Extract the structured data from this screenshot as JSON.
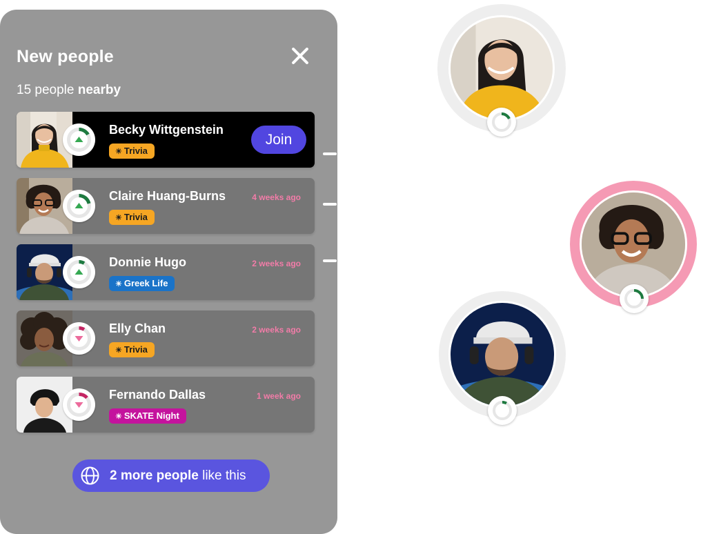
{
  "panel": {
    "title": "New people",
    "nearby_count": "15 people",
    "nearby_word": "nearby",
    "close_icon": "close-icon"
  },
  "people": [
    {
      "name": "Becky Wittgenstein",
      "tag": "Trivia",
      "tag_color": "#f6a623",
      "time": "",
      "action": "Join",
      "active": true,
      "status": "up",
      "status_color": "#35a852"
    },
    {
      "name": "Claire Huang-Burns",
      "tag": "Trivia",
      "tag_color": "#f6a623",
      "time": "4 weeks ago",
      "active": false,
      "status": "up",
      "status_color": "#35a852"
    },
    {
      "name": "Donnie Hugo",
      "tag": "Greek Life",
      "tag_color": "#1a73c8",
      "time": "2 weeks ago",
      "active": false,
      "status": "up",
      "status_color": "#35a852"
    },
    {
      "name": "Elly Chan",
      "tag": "Trivia",
      "tag_color": "#f6a623",
      "time": "2 weeks ago",
      "active": false,
      "status": "down",
      "status_color": "#e0457f"
    },
    {
      "name": "Fernando Dallas",
      "tag": "SKATE Night",
      "tag_color": "#c4139d",
      "time": "1 week ago",
      "active": false,
      "status": "down",
      "status_color": "#e0457f"
    }
  ],
  "more_button": {
    "icon": "globe-icon",
    "bold": "2 more people",
    "rest": "like this"
  },
  "map": {
    "accent_pink": "#f59ab4",
    "accent_purple": "#5146e0"
  }
}
